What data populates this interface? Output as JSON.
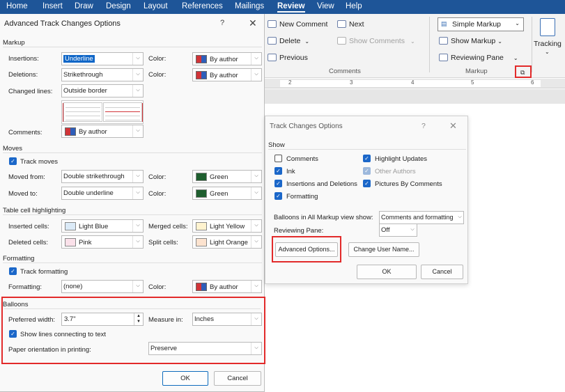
{
  "menubar": {
    "items": [
      "Home",
      "Insert",
      "Draw",
      "Design",
      "Layout",
      "References",
      "Mailings",
      "Review",
      "View",
      "Help"
    ],
    "active": "Review"
  },
  "ribbon": {
    "new_comment": "New Comment",
    "next": "Next",
    "delete": "Delete",
    "show_comments": "Show Comments",
    "previous": "Previous",
    "comments_group": "Comments",
    "markup_select": "Simple Markup",
    "show_markup": "Show Markup",
    "reviewing_pane": "Reviewing Pane",
    "markup_group": "Markup",
    "tracking": "Tracking",
    "ruler_numbers": [
      "2",
      "3",
      "4",
      "5",
      "6"
    ]
  },
  "advanced": {
    "title": "Advanced Track Changes Options",
    "help": "?",
    "close": "✕",
    "markup": {
      "section": "Markup",
      "insertions_label": "Insertions:",
      "insertions_value": "Underline",
      "insertions_color_label": "Color:",
      "insertions_color": "By author",
      "deletions_label": "Deletions:",
      "deletions_value": "Strikethrough",
      "deletions_color_label": "Color:",
      "deletions_color": "By author",
      "changed_lines_label": "Changed lines:",
      "changed_lines_value": "Outside border",
      "comments_label": "Comments:",
      "comments_value": "By author"
    },
    "moves": {
      "section": "Moves",
      "track_moves": "Track moves",
      "moved_from_label": "Moved from:",
      "moved_from_value": "Double strikethrough",
      "moved_from_color_label": "Color:",
      "moved_from_color": "Green",
      "moved_to_label": "Moved to:",
      "moved_to_value": "Double underline",
      "moved_to_color_label": "Color:",
      "moved_to_color": "Green"
    },
    "table": {
      "section": "Table cell highlighting",
      "inserted_label": "Inserted cells:",
      "inserted_value": "Light Blue",
      "merged_label": "Merged cells:",
      "merged_value": "Light Yellow",
      "deleted_label": "Deleted cells:",
      "deleted_value": "Pink",
      "split_label": "Split cells:",
      "split_value": "Light Orange"
    },
    "formatting": {
      "section": "Formatting",
      "track_formatting": "Track formatting",
      "formatting_label": "Formatting:",
      "formatting_value": "(none)",
      "color_label": "Color:",
      "color_value": "By author"
    },
    "balloons": {
      "section": "Balloons",
      "preferred_width_label": "Preferred width:",
      "preferred_width_value": "3.7\"",
      "measure_label": "Measure in:",
      "measure_value": "Inches",
      "show_lines": "Show lines connecting to text",
      "paper_label": "Paper orientation in printing:",
      "paper_value": "Preserve"
    },
    "ok": "OK",
    "cancel": "Cancel"
  },
  "track_options": {
    "title": "Track Changes Options",
    "help": "?",
    "close": "✕",
    "show_label": "Show",
    "comments": "Comments",
    "ink": "Ink",
    "insertions_deletions": "Insertions and Deletions",
    "formatting": "Formatting",
    "highlight_updates": "Highlight Updates",
    "other_authors": "Other Authors",
    "pictures_by_comments": "Pictures By Comments",
    "balloons_label": "Balloons in All Markup view show:",
    "balloons_value": "Comments and formatting",
    "reviewing_pane_label": "Reviewing Pane:",
    "reviewing_pane_value": "Off",
    "advanced_button": "Advanced Options...",
    "change_user_button": "Change User Name...",
    "ok": "OK",
    "cancel": "Cancel"
  },
  "colors": {
    "accent": "#1b67c9",
    "highlight_red": "#e22a2a",
    "green": "#1e5e2e",
    "light_blue": "#dbeaf7",
    "light_yellow": "#fff3cf",
    "pink": "#fbe1ea",
    "light_orange": "#fde3cf"
  }
}
